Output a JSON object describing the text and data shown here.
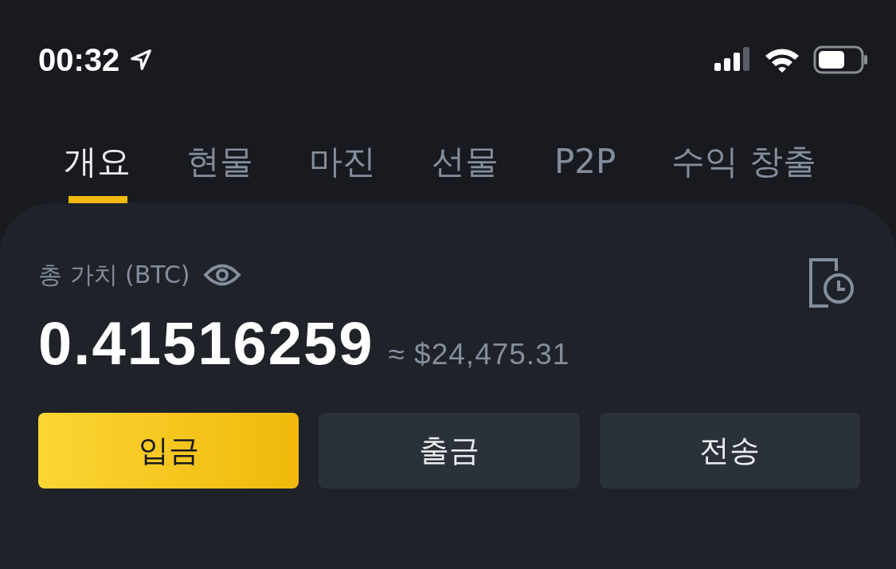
{
  "status_bar": {
    "time": "00:32"
  },
  "tabs": [
    {
      "label": "개요",
      "selected": true
    },
    {
      "label": "현물",
      "selected": false
    },
    {
      "label": "마진",
      "selected": false
    },
    {
      "label": "선물",
      "selected": false
    },
    {
      "label": "P2P",
      "selected": false
    },
    {
      "label": "수익 창출",
      "selected": false
    }
  ],
  "balance": {
    "label": "총 가치 (BTC)",
    "value": "0.41516259",
    "fiat": "≈ $24,475.31"
  },
  "buttons": [
    {
      "label": "입금",
      "kind": "primary"
    },
    {
      "label": "출금",
      "kind": "secondary"
    },
    {
      "label": "전송",
      "kind": "secondary"
    }
  ]
}
